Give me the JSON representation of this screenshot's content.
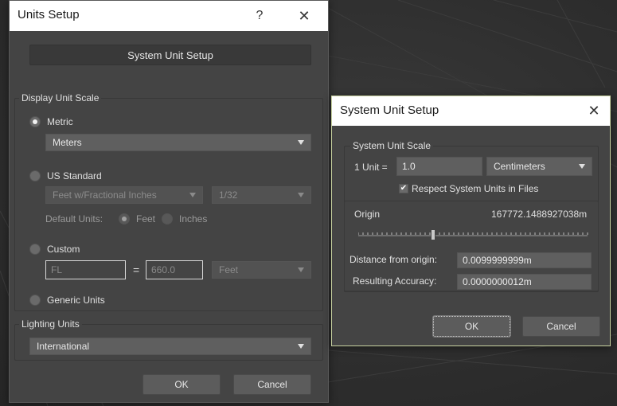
{
  "units_dialog": {
    "title": "Units Setup",
    "help_glyph": "?",
    "close_glyph": "✕",
    "system_unit_setup_button": "System Unit Setup",
    "display_unit_scale": {
      "label": "Display Unit Scale",
      "metric_label": "Metric",
      "metric_value": "Meters",
      "us_standard_label": "US Standard",
      "us_units_value": "Feet w/Fractional Inches",
      "us_fraction_value": "1/32",
      "default_units_label": "Default Units:",
      "feet_label": "Feet",
      "inches_label": "Inches",
      "custom_label": "Custom",
      "custom_name_value": "FL",
      "equals": "=",
      "custom_amount_value": "660.0",
      "custom_unit_value": "Feet",
      "generic_label": "Generic Units"
    },
    "lighting_units": {
      "label": "Lighting Units",
      "value": "International"
    },
    "ok_label": "OK",
    "cancel_label": "Cancel"
  },
  "system_dialog": {
    "title": "System Unit Setup",
    "close_glyph": "✕",
    "system_unit_scale": {
      "label": "System Unit Scale",
      "unit_label": "1 Unit =",
      "unit_value": "1.0",
      "unit_type": "Centimeters",
      "respect_label": "Respect System Units in Files",
      "respect_checked": true
    },
    "origin": {
      "label": "Origin",
      "value": "167772.1488927038m",
      "distance_label": "Distance from origin:",
      "distance_value": "0.0099999999m",
      "accuracy_label": "Resulting Accuracy:",
      "accuracy_value": "0.0000000012m"
    },
    "ok_label": "OK",
    "cancel_label": "Cancel"
  }
}
